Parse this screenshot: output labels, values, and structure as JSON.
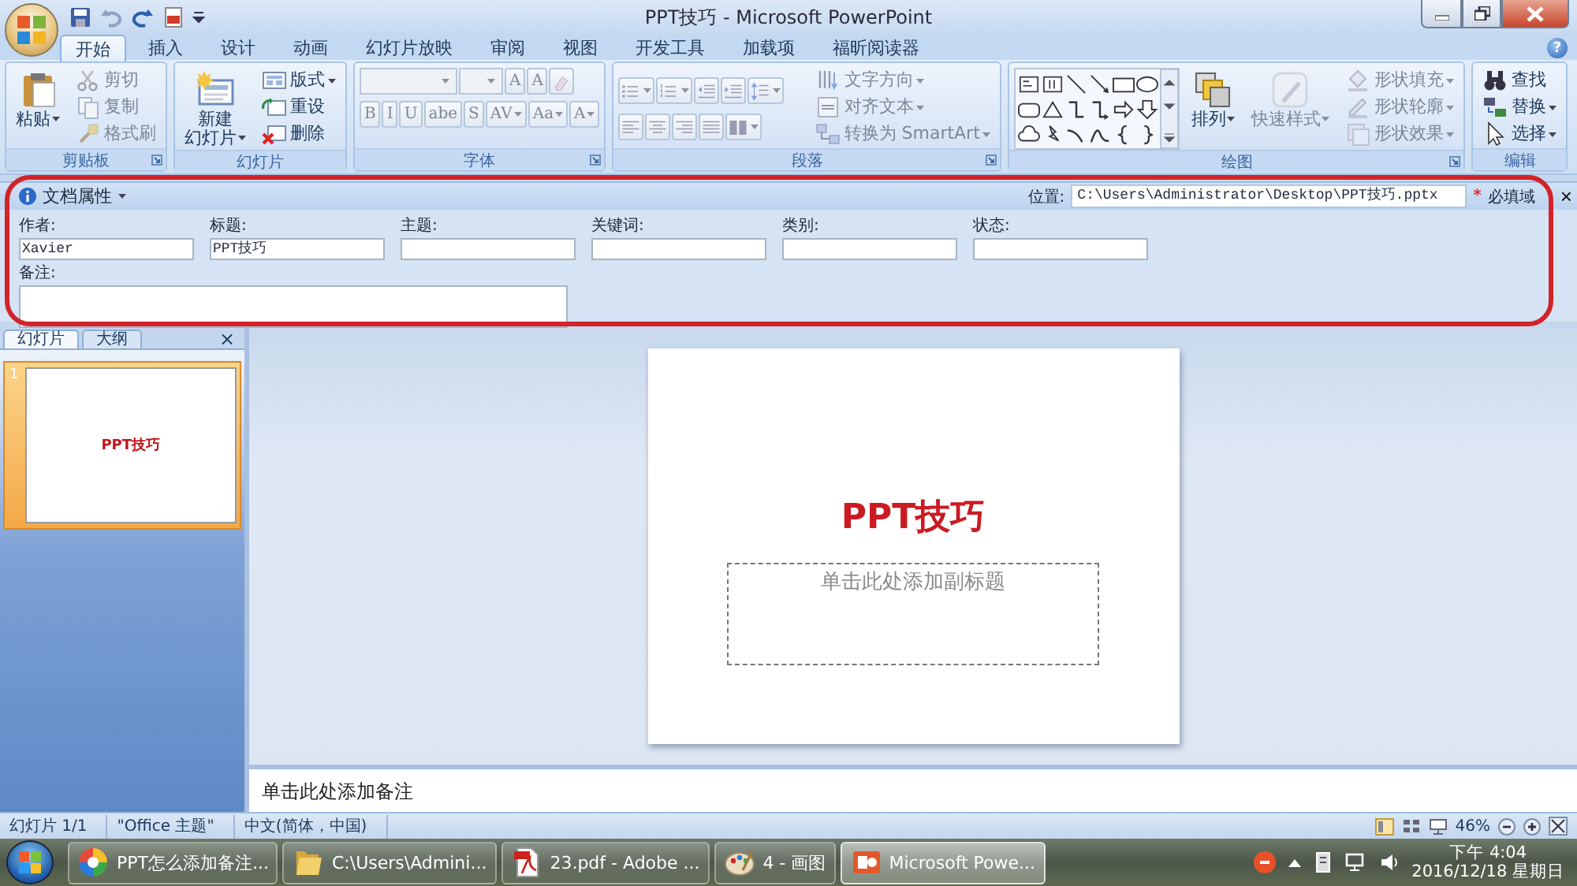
{
  "window": {
    "title": "PPT技巧 - Microsoft PowerPoint"
  },
  "tabs": [
    {
      "label": "开始",
      "selected": true
    },
    {
      "label": "插入",
      "selected": false
    },
    {
      "label": "设计",
      "selected": false
    },
    {
      "label": "动画",
      "selected": false
    },
    {
      "label": "幻灯片放映",
      "selected": false
    },
    {
      "label": "审阅",
      "selected": false
    },
    {
      "label": "视图",
      "selected": false
    },
    {
      "label": "开发工具",
      "selected": false
    },
    {
      "label": "加载项",
      "selected": false
    },
    {
      "label": "福昕阅读器",
      "selected": false
    }
  ],
  "help": "?",
  "ribbon_groups": [
    {
      "label": "剪贴板",
      "kind": "columns",
      "launcher": true,
      "sections": [
        [
          {
            "kind": "large",
            "lines": [
              "粘贴"
            ],
            "menu": true,
            "disabled": false
          }
        ],
        [
          {
            "kind": "small",
            "label": "剪切",
            "menu": false,
            "disabled": true
          },
          {
            "kind": "small",
            "label": "复制",
            "menu": false,
            "disabled": true
          },
          {
            "kind": "small",
            "label": "格式刷",
            "menu": false,
            "disabled": true
          }
        ]
      ]
    },
    {
      "label": "幻灯片",
      "kind": "columns",
      "launcher": false,
      "sections": [
        [
          {
            "kind": "large",
            "lines": [
              "新建",
              "幻灯片"
            ],
            "menu": true,
            "disabled": false
          }
        ],
        [
          {
            "kind": "small",
            "label": "版式",
            "menu": true,
            "disabled": false
          },
          {
            "kind": "small",
            "label": "重设",
            "menu": false,
            "disabled": false
          },
          {
            "kind": "small",
            "label": "删除",
            "menu": false,
            "disabled": false
          }
        ]
      ]
    },
    {
      "label": "字体",
      "kind": "rows",
      "launcher": true,
      "sections": [
        [
          {
            "kind": "combo",
            "menu": true,
            "disabled": true
          },
          {
            "kind": "combo",
            "menu": true,
            "disabled": true
          },
          {
            "kind": "glyph",
            "label": "A",
            "menu": false,
            "disabled": true
          },
          {
            "kind": "glyph",
            "label": "A",
            "menu": false,
            "disabled": true
          },
          {
            "kind": "icon",
            "menu": false,
            "disabled": true
          }
        ],
        [
          {
            "kind": "glyph",
            "label": "B",
            "menu": false,
            "disabled": true
          },
          {
            "kind": "glyph",
            "label": "I",
            "menu": false,
            "disabled": true
          },
          {
            "kind": "glyph",
            "label": "U",
            "menu": false,
            "disabled": true
          },
          {
            "kind": "glyph",
            "label": "abe",
            "menu": false,
            "disabled": true
          },
          {
            "kind": "glyph",
            "label": "S",
            "menu": false,
            "disabled": true
          },
          {
            "kind": "glyph",
            "label": "AV",
            "menu": true,
            "disabled": true
          },
          {
            "kind": "glyph",
            "label": "Aa",
            "menu": true,
            "disabled": true
          },
          {
            "kind": "glyph",
            "label": "A",
            "menu": true,
            "disabled": true
          }
        ]
      ]
    },
    {
      "label": "段落",
      "kind": "columns",
      "launcher": true,
      "sections": [
        [
          {
            "kind": "icon",
            "menu": true,
            "disabled": true
          },
          {
            "kind": "icon",
            "menu": true,
            "disabled": true
          },
          {
            "kind": "icon",
            "menu": false,
            "disabled": true
          },
          {
            "kind": "icon",
            "menu": false,
            "disabled": true
          },
          {
            "kind": "icon",
            "menu": true,
            "disabled": true
          },
          {
            "kind": "icon",
            "menu": false,
            "disabled": true
          },
          {
            "kind": "icon",
            "menu": false,
            "disabled": true
          },
          {
            "kind": "icon",
            "menu": false,
            "disabled": true
          },
          {
            "kind": "icon",
            "menu": false,
            "disabled": true
          },
          {
            "kind": "icon",
            "menu": true,
            "disabled": true
          }
        ],
        [
          {
            "kind": "small",
            "label": "文字方向",
            "menu": true,
            "disabled": true
          },
          {
            "kind": "small",
            "label": "对齐文本",
            "menu": true,
            "disabled": true
          },
          {
            "kind": "small",
            "label": "转换为 SmartArt",
            "menu": true,
            "disabled": true
          }
        ]
      ]
    },
    {
      "label": "绘图",
      "kind": "columns",
      "launcher": true,
      "sections": [
        [
          {
            "kind": "gallery",
            "menu": true,
            "disabled": false
          }
        ],
        [
          {
            "kind": "large",
            "lines": [
              "排列"
            ],
            "menu": true,
            "disabled": false
          }
        ],
        [
          {
            "kind": "large",
            "lines": [
              "快速样式"
            ],
            "menu": true,
            "disabled": true
          }
        ],
        [
          {
            "kind": "small",
            "label": "形状填充",
            "menu": true,
            "disabled": true
          },
          {
            "kind": "small",
            "label": "形状轮廓",
            "menu": true,
            "disabled": true
          },
          {
            "kind": "small",
            "label": "形状效果",
            "menu": true,
            "disabled": true
          }
        ]
      ]
    },
    {
      "label": "编辑",
      "kind": "columns",
      "launcher": false,
      "sections": [
        [
          {
            "kind": "small",
            "label": "查找",
            "menu": false,
            "disabled": false
          },
          {
            "kind": "small",
            "label": "替换",
            "menu": true,
            "disabled": false
          },
          {
            "kind": "small",
            "label": "选择",
            "menu": true,
            "disabled": false
          }
        ]
      ]
    }
  ],
  "document_properties": {
    "title": "文档属性",
    "location_label": "位置:",
    "location": "C:\\Users\\Administrator\\Desktop\\PPT技巧.pptx",
    "required_mark": "*",
    "required_label": "必填域",
    "close": "×",
    "fields": [
      {
        "label": "作者:",
        "value": "Xavier"
      },
      {
        "label": "标题:",
        "value": "PPT技巧"
      },
      {
        "label": "主题:"
      },
      {
        "label": "关键词:"
      },
      {
        "label": "类别:"
      },
      {
        "label": "状态:"
      }
    ],
    "comments": {
      "label": "备注:"
    }
  },
  "slides_pane": {
    "tabs": [
      {
        "label": "幻灯片",
        "selected": true
      },
      {
        "label": "大纲",
        "selected": false
      }
    ],
    "close": "×",
    "thumbnails": [
      {
        "number": "1",
        "title": "PPT技巧",
        "selected": true
      }
    ]
  },
  "slide": {
    "title": "PPT技巧",
    "subtitle": "单击此处添加副标题"
  },
  "notes": {
    "placeholder": "单击此处添加备注"
  },
  "status_bar": {
    "items": [
      "幻灯片 1/1",
      "\"Office 主题\"",
      "中文(简体，中国)"
    ],
    "zoom": "46%"
  },
  "taskbar": {
    "tasks": [
      {
        "label": "PPT怎么添加备注...",
        "selected": false
      },
      {
        "label": "C:\\Users\\Admini...",
        "selected": false
      },
      {
        "label": "23.pdf - Adobe ...",
        "selected": false
      },
      {
        "label": "4 - 画图",
        "selected": false
      },
      {
        "label": "Microsoft Powe...",
        "selected": true
      }
    ],
    "time": "下午 4:04",
    "date": "2016/12/18 星期日"
  }
}
